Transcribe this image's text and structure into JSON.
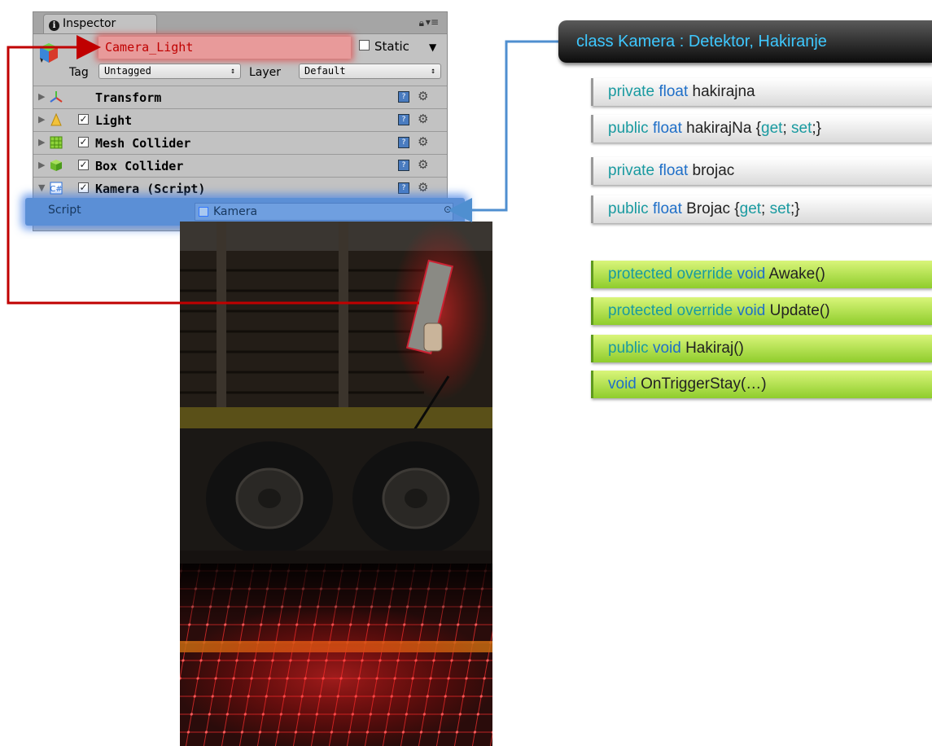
{
  "inspector": {
    "tab_label": "Inspector",
    "object_name": "Camera_Light",
    "static_label": "Static",
    "tag_label": "Tag",
    "tag_value": "Untagged",
    "layer_label": "Layer",
    "layer_value": "Default",
    "components": [
      {
        "label": "Transform",
        "has_checkbox": false,
        "icon": "transform-icon"
      },
      {
        "label": "Light",
        "has_checkbox": true,
        "icon": "light-icon"
      },
      {
        "label": "Mesh Collider",
        "has_checkbox": true,
        "icon": "mesh-collider-icon"
      },
      {
        "label": "Box Collider",
        "has_checkbox": true,
        "icon": "box-collider-icon"
      },
      {
        "label": "Kamera (Script)",
        "has_checkbox": true,
        "icon": "script-icon"
      }
    ],
    "script_label": "Script",
    "script_value": "Kamera"
  },
  "class_panel": {
    "header_keyword": "class",
    "header_rest": "Kamera : Detektor, Hakiranje",
    "fields": [
      {
        "mod": "private",
        "type": "float",
        "name": "hakirajna",
        "accessors": false
      },
      {
        "mod": "public",
        "type": "float",
        "name": "hakirajNa {",
        "accessors": true
      },
      {
        "mod": "private",
        "type": "float",
        "name": "brojac",
        "accessors": false
      },
      {
        "mod": "public",
        "type": "float",
        "name": "Brojac {",
        "accessors": true
      }
    ],
    "accessor_get": "get",
    "accessor_sep": "; ",
    "accessor_set": "set",
    "accessor_end": ";}",
    "methods": [
      {
        "kw1": "protected",
        "kw2": "override",
        "kw3": "void",
        "name": "Awake()"
      },
      {
        "kw1": "protected",
        "kw2": "override",
        "kw3": "void",
        "name": "Update()"
      },
      {
        "kw1": "public",
        "kw2": "",
        "kw3": "void",
        "name": "Hakiraj()"
      },
      {
        "kw1": "",
        "kw2": "",
        "kw3": "void",
        "name": "OnTriggerStay(…)"
      }
    ]
  },
  "colors": {
    "highlight_red": "#c00000",
    "highlight_blue": "#5b8fd6",
    "keyword_teal": "#199aa0",
    "keyword_blue": "#1f6fc8",
    "method_green": "#8fcd2c"
  }
}
